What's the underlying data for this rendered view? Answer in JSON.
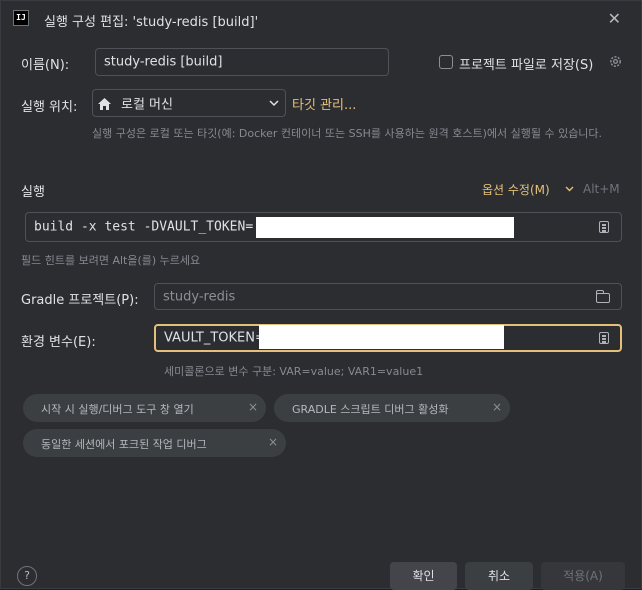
{
  "window": {
    "app_icon_text": "IJ",
    "title": "실행 구성 편집: 'study-redis [build]'",
    "close": "✕"
  },
  "name": {
    "label": "이름(N):",
    "value": "study-redis [build]"
  },
  "store_project": {
    "label": "프로젝트 파일로 저장(S)",
    "checked": false
  },
  "run_on": {
    "label": "실행 위치:",
    "value": "로컬 머신",
    "manage_link": "타깃 관리...",
    "description": "실행 구성은 로컬 또는 타깃(예: Docker 컨테이너 또는 SSH를 사용하는 원격 호스트)에서 실행될 수 있습니다."
  },
  "run": {
    "section_label": "실행",
    "modify_options": "옵션 수정(M)",
    "shortcut": "Alt+M",
    "command": "build -x test -DVAULT_TOKEN=",
    "field_hint": "필드 힌트를 보려면 Alt을(를) 누르세요"
  },
  "gradle_project": {
    "label": "Gradle 프로젝트(P):",
    "value": "study-redis"
  },
  "env_vars": {
    "label": "환경 변수(E):",
    "value": "VAULT_TOKEN=",
    "hint": "세미콜론으로 변수 구분: VAR=value; VAR1=value1"
  },
  "chips": [
    {
      "label": "시작 시 실행/디버그 도구 창 열기"
    },
    {
      "label": "GRADLE 스크립트 디버그 활성화"
    },
    {
      "label": "동일한 세션에서 포크된 작업 디버그"
    }
  ],
  "chip_close": "×",
  "footer": {
    "help": "?",
    "ok": "확인",
    "cancel": "취소",
    "apply": "적용(A)"
  },
  "colors": {
    "accent_link": "#e5c07b",
    "focus_border": "#e5c07b",
    "background": "#2b2d30"
  }
}
